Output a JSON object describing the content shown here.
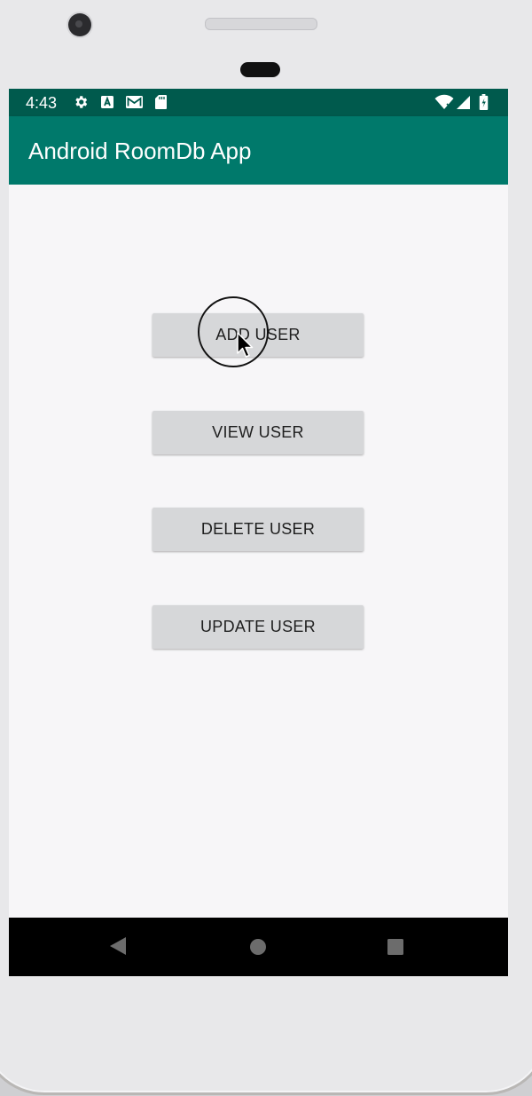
{
  "status_bar": {
    "time": "4:43",
    "left_icons": [
      "gear-icon",
      "a-box-icon",
      "gmail-icon",
      "sd-card-icon"
    ],
    "right_icons": [
      "wifi-icon",
      "signal-icon",
      "battery-icon"
    ],
    "color": "#005a4d"
  },
  "app_bar": {
    "title": "Android RoomDb App",
    "color": "#00796b"
  },
  "buttons": {
    "add_user": "ADD USER",
    "view_user": "VIEW USER",
    "delete_user": "DELETE USER",
    "update_user": "UPDATE USER"
  },
  "nav_bar": {
    "items": [
      "back-icon",
      "home-icon",
      "recents-icon"
    ]
  }
}
